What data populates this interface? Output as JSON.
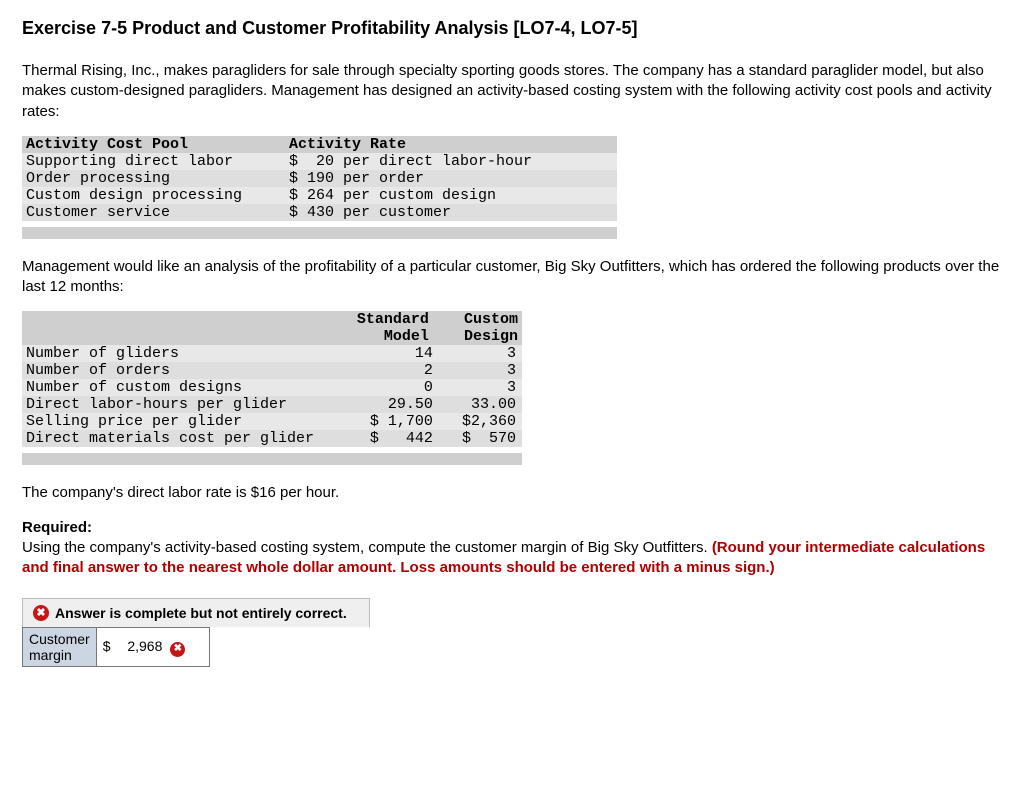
{
  "title": "Exercise 7-5 Product and Customer Profitability Analysis [LO7-4, LO7-5]",
  "intro": "Thermal Rising, Inc., makes paragliders for sale through specialty sporting goods stores. The company has a standard paraglider model, but also makes custom-designed paragliders. Management has designed an activity-based costing system with the following activity cost pools and activity rates:",
  "table1": {
    "headers": {
      "pool": "Activity Cost Pool",
      "rate": "Activity Rate"
    },
    "rows": [
      {
        "pool": "Supporting direct labor",
        "rate": "$  20 per direct labor-hour"
      },
      {
        "pool": "Order processing",
        "rate": "$ 190 per order"
      },
      {
        "pool": "Custom design processing",
        "rate": "$ 264 per custom design"
      },
      {
        "pool": "Customer service",
        "rate": "$ 430 per customer"
      }
    ]
  },
  "para2": "Management would like an analysis of the profitability of a particular customer, Big Sky Outfitters, which has ordered the following products over the last 12 months:",
  "table2": {
    "col_headers": {
      "row1": {
        "c1": "Standard",
        "c2": "Custom"
      },
      "row2": {
        "c1": "Model",
        "c2": "Design"
      }
    },
    "rows": [
      {
        "label": "Number of gliders",
        "std": "14",
        "cus": "3"
      },
      {
        "label": "Number of orders",
        "std": "2",
        "cus": "3"
      },
      {
        "label": "Number of custom designs",
        "std": "0",
        "cus": "3"
      },
      {
        "label": "Direct labor-hours per glider",
        "std": "29.50",
        "cus": "33.00"
      },
      {
        "label": "Selling price per glider",
        "std": "$ 1,700",
        "cus": "$2,360"
      },
      {
        "label": "Direct materials cost per glider",
        "std": "$   442",
        "cus": "$  570"
      }
    ]
  },
  "para3": "The company's direct labor rate is $16 per hour.",
  "required_label": "Required:",
  "required_text": "Using the company's activity-based costing system, compute the customer margin of Big Sky Outfitters. ",
  "required_note": "(Round your intermediate calculations and final answer to the nearest whole dollar amount. Loss amounts should be entered with a minus sign.)",
  "feedback": {
    "header": "Answer is complete but not entirely correct.",
    "row_label_line1": "Customer",
    "row_label_line2": "margin",
    "currency": "$",
    "value": "2,968"
  }
}
